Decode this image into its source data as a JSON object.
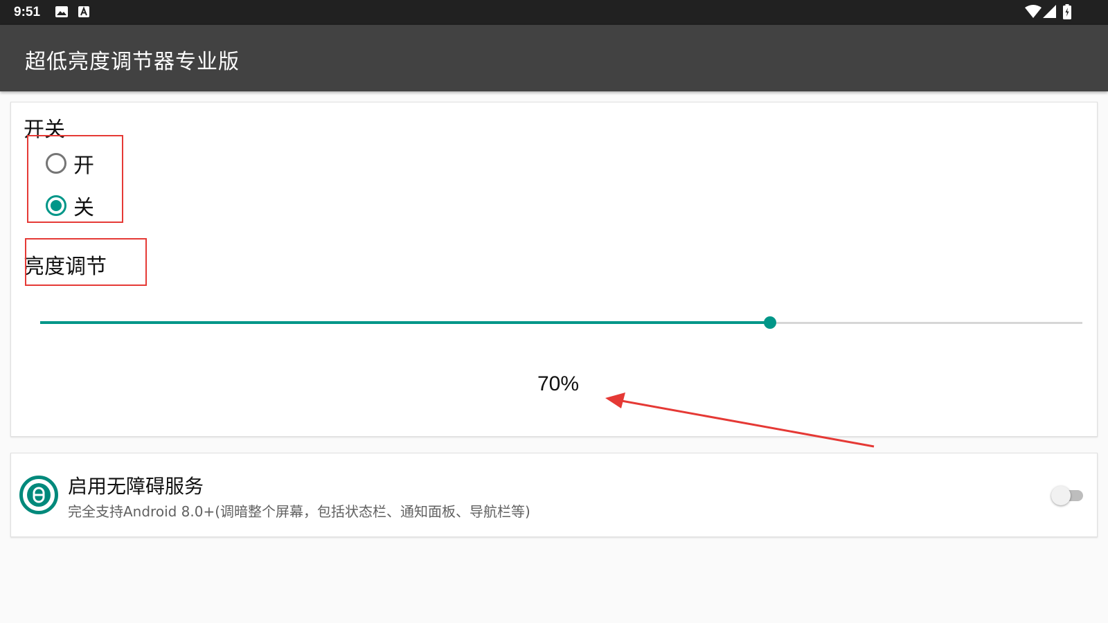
{
  "status_bar": {
    "time": "9:51",
    "left_icons": [
      "image-icon",
      "text-a-icon"
    ],
    "right_icons": [
      "wifi-icon",
      "signal-icon",
      "battery-icon"
    ]
  },
  "app_bar": {
    "title": "超低亮度调节器专业版"
  },
  "main_card": {
    "switch_label": "开关",
    "radio_options": [
      {
        "label": "开",
        "checked": false
      },
      {
        "label": "关",
        "checked": true
      }
    ],
    "brightness_label": "亮度调节",
    "brightness_value": 0.7,
    "brightness_percent": "70%"
  },
  "service_card": {
    "title": "启用无障碍服务",
    "description": "完全支持Android 8.0+(调暗整个屏幕，包括状态栏、通知面板、导航栏等)",
    "toggle_on": false,
    "icon": "accessibility-service-icon"
  },
  "colors": {
    "accent": "#009688",
    "status_bar": "#212121",
    "app_bar": "#424242",
    "annotation": "#e53935"
  }
}
